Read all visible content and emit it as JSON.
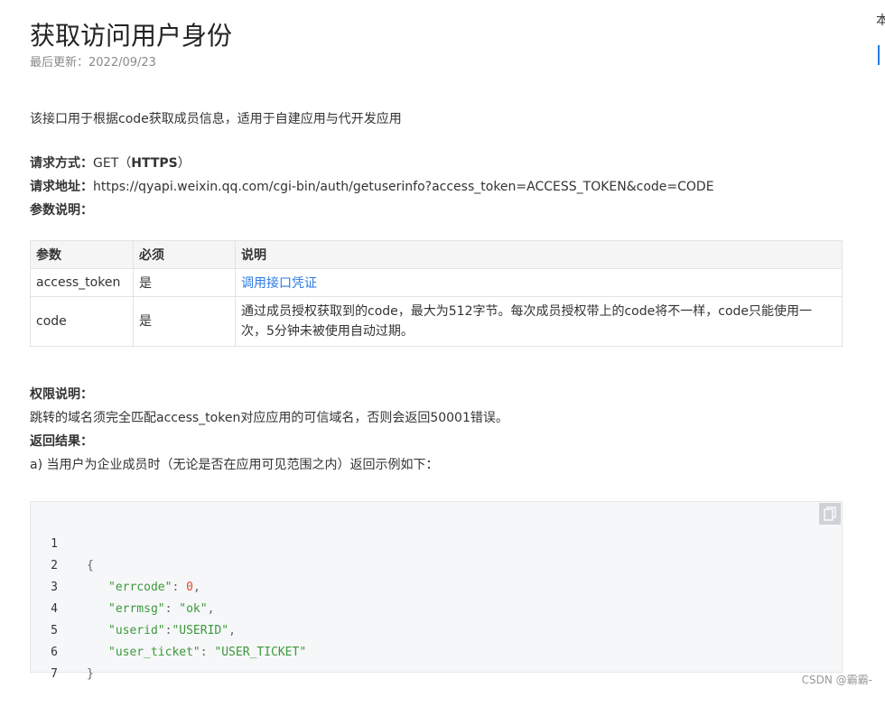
{
  "page": {
    "title": "获取访问用户身份",
    "updated": "最后更新：2022/09/23",
    "intro": "该接口用于根据code获取成员信息，适用于自建应用与代开发应用",
    "edge_char": "本"
  },
  "request": {
    "method_label": "请求方式：",
    "method_value": "GET（",
    "method_protocol": "HTTPS",
    "method_close": "）",
    "url_label": "请求地址：",
    "url_value": "https://qyapi.weixin.qq.com/cgi-bin/auth/getuserinfo?access_token=ACCESS_TOKEN&code=CODE",
    "params_label": "参数说明："
  },
  "params_table": {
    "headers": [
      "参数",
      "必须",
      "说明"
    ],
    "rows": [
      {
        "name": "access_token",
        "required": "是",
        "desc": "调用接口凭证"
      },
      {
        "name": "code",
        "required": "是",
        "desc": "通过成员授权获取到的code，最大为512字节。每次成员授权带上的code将不一样，code只能使用一次，5分钟未被使用自动过期。"
      }
    ]
  },
  "permissions": {
    "label": "权限说明：",
    "text": "跳转的域名须完全匹配access_token对应应用的可信域名，否则会返回50001错误。"
  },
  "result": {
    "label": "返回结果：",
    "case_a": "a) 当用户为企业成员时（无论是否在应用可见范围之内）返回示例如下："
  },
  "code_sample": {
    "line_numbers": [
      "1",
      "2",
      "3",
      "4",
      "5",
      "6",
      "7"
    ],
    "open_brace": "{",
    "close_brace": "}",
    "errcode_key": "\"errcode\"",
    "errcode_val": "0",
    "errmsg_key": "\"errmsg\"",
    "errmsg_val": "\"ok\"",
    "userid_key": "\"userid\"",
    "userid_val": "\"USERID\"",
    "user_ticket_key": "\"user_ticket\"",
    "user_ticket_val": "\"USER_TICKET\"",
    "copy_icon": "copy-icon"
  },
  "watermark": "CSDN @霸霸-"
}
